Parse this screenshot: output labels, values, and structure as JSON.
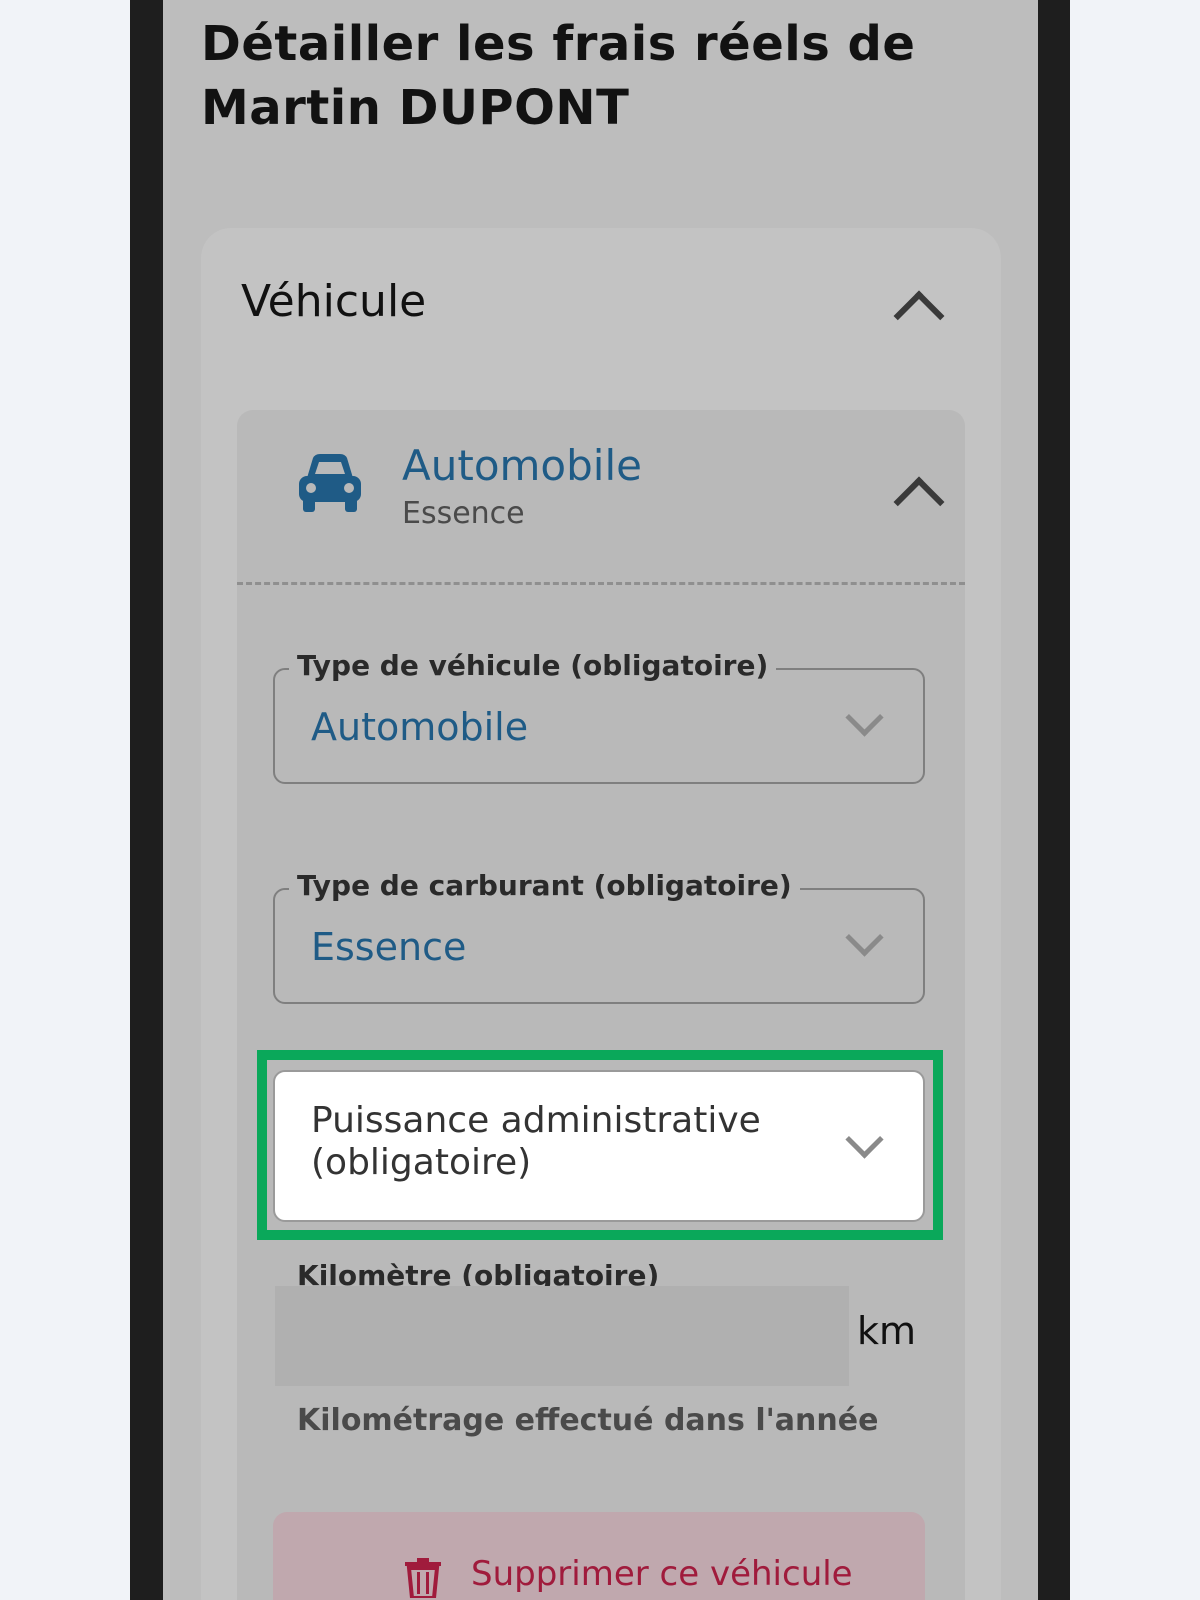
{
  "page": {
    "title": "Détailler les frais réels de Martin DUPONT"
  },
  "section": {
    "title": "Véhicule"
  },
  "vehicle": {
    "name": "Automobile",
    "fuel": "Essence"
  },
  "form": {
    "vehicle_type": {
      "label": "Type de véhicule (obligatoire)",
      "value": "Automobile"
    },
    "fuel_type": {
      "label": "Type de carburant (obligatoire)",
      "value": "Essence"
    },
    "power": {
      "label": "Puissance administrative (obligatoire)"
    },
    "km": {
      "label": "Kilomètre (obligatoire)",
      "unit": "km",
      "hint": "Kilométrage effectué dans l'année",
      "value": ""
    }
  },
  "actions": {
    "delete_label": "Supprimer ce véhicule"
  },
  "colors": {
    "accent": "#1f5b86",
    "highlight": "#0aa85a",
    "danger": "#a01b3c"
  },
  "icons": {
    "vehicle": "car-icon",
    "delete": "trash-icon"
  }
}
